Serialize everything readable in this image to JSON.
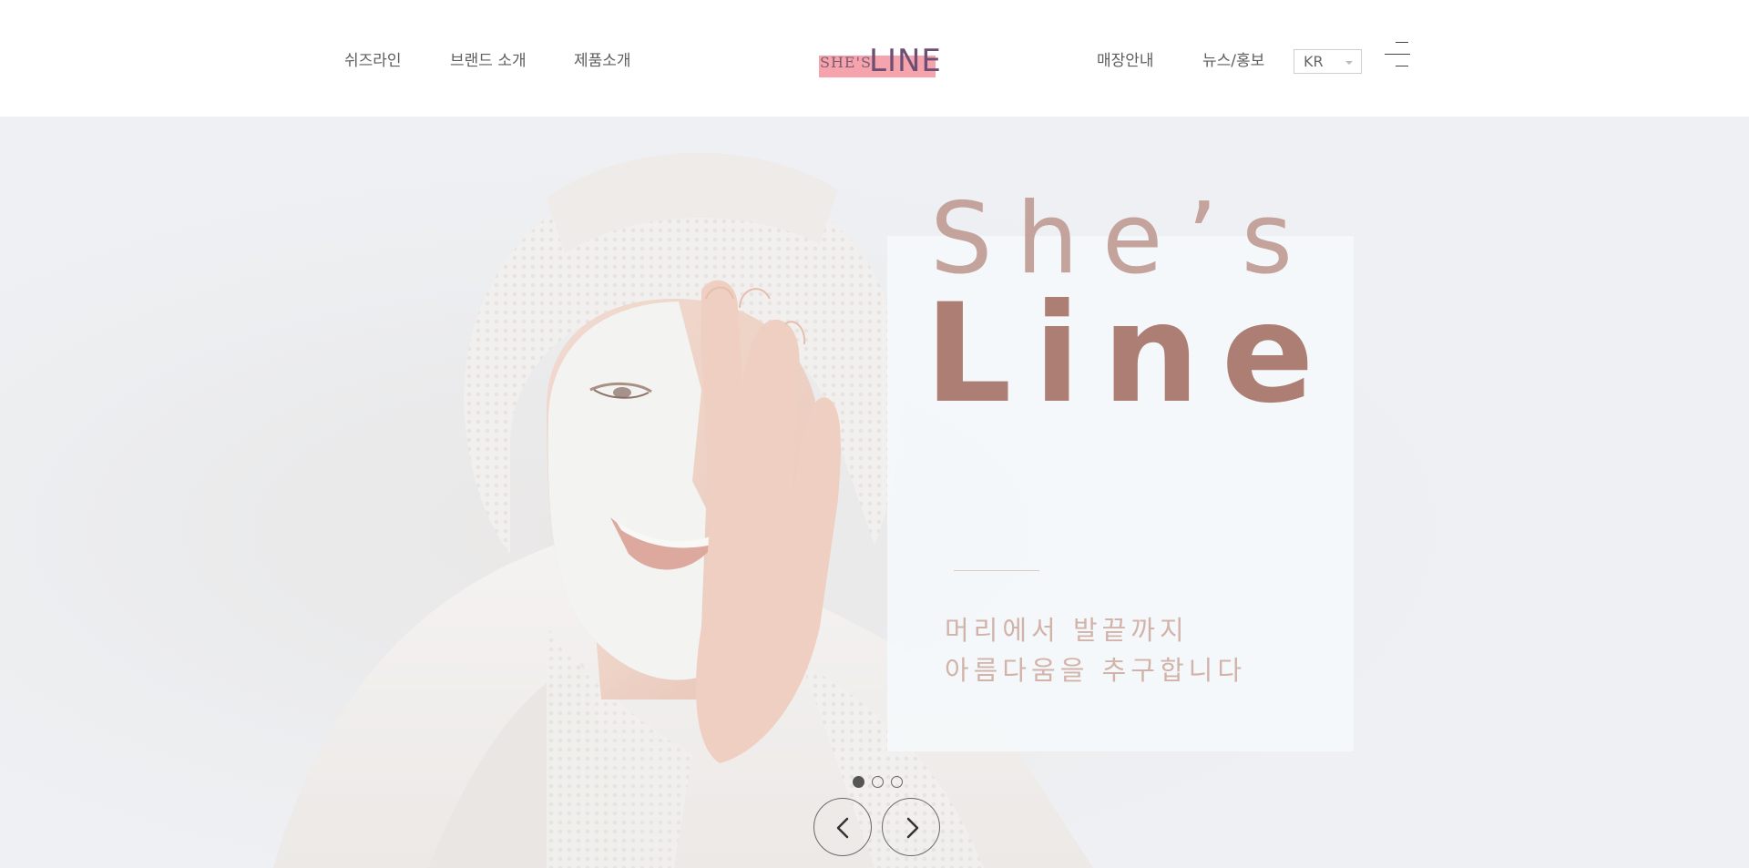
{
  "nav": {
    "left": [
      {
        "label": "쉬즈라인"
      },
      {
        "label": "브랜드 소개"
      },
      {
        "label": "제품소개"
      }
    ],
    "right": [
      {
        "label": "매장안내"
      },
      {
        "label": "뉴스/홍보"
      }
    ]
  },
  "logo": {
    "small": "SHE'S",
    "big": "LINE",
    "bar_color": "#f5a3ad"
  },
  "language": {
    "selected": "KR"
  },
  "menu": {
    "icon": "hamburger-menu-icon"
  },
  "hero": {
    "title_top": "She’s",
    "title_main": "Line",
    "subtitle_line1": "머리에서 발끝까지",
    "subtitle_line2": "아름다움을 추구합니다",
    "title_color": "#ad7e74",
    "background": "#eef1f4"
  },
  "slider": {
    "total_slides": 3,
    "active_slide": 1,
    "prev_icon": "chevron-left-icon",
    "next_icon": "chevron-right-icon"
  }
}
